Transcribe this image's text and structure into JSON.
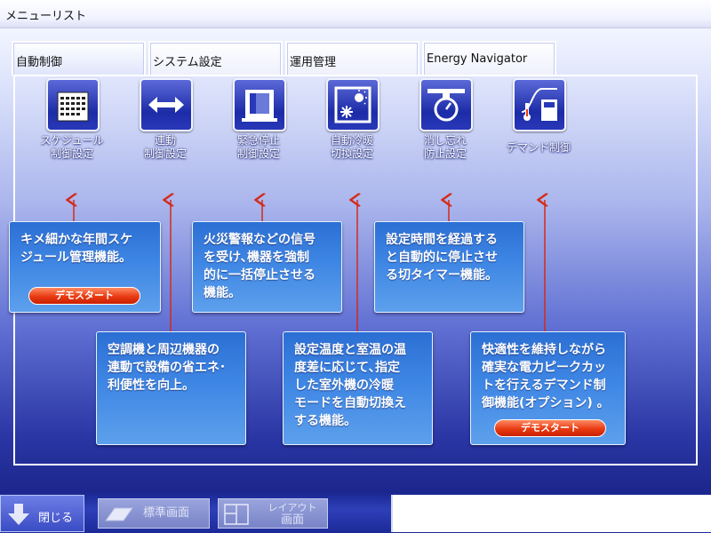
{
  "window": {
    "title": "メニューリスト"
  },
  "tabs": [
    {
      "label": "自動制御",
      "active": true
    },
    {
      "label": "システム設定",
      "active": false
    },
    {
      "label": "運用管理",
      "active": false
    },
    {
      "label": "Energy Navigator",
      "active": false
    }
  ],
  "functions": [
    {
      "icon": "calendar-icon",
      "line1": "スケジュール",
      "line2": "制御設定"
    },
    {
      "icon": "double-arrow-icon",
      "line1": "連動",
      "line2": "制御設定"
    },
    {
      "icon": "emergency-stop-icon",
      "line1": "緊急停止",
      "line2": "制御設定"
    },
    {
      "icon": "heat-cool-switch-icon",
      "line1": "自動冷暖",
      "line2": "切換設定"
    },
    {
      "icon": "stopwatch-icon",
      "line1": "消し忘れ",
      "line2": "防止設定"
    },
    {
      "icon": "demand-meter-icon",
      "line1": "デマンド制御",
      "line2": ""
    }
  ],
  "descriptions": {
    "schedule": "キメ細かな年間スケ\nジュール管理機能。",
    "interlock": "空調機と周辺機器の\n連動で設備の省エネ･\n利便性を向上。",
    "emergency": "火災警報などの信号\nを受け､機器を強制\n的に一括停止させる\n機能。",
    "auto_switch": "設定温度と室温の温\n度差に応じて､指定\nした室外機の冷暖\nモードを自動切換え\nする機能。",
    "off_timer": "設定時間を経過する\nと自動的に停止させ\nる切タイマー機能。",
    "demand": "快適性を維持しながら\n確実な電力ピークカッ\nトを行えるデマンド制\n御機能(オプション) 。"
  },
  "demo_button_label": "デモスタート",
  "bottom": {
    "close_label": "閉じる",
    "standard_screen_label": "標準画面",
    "layout_screen_line1": "レイアウト",
    "layout_screen_line2": "画面"
  },
  "colors": {
    "arrow": "#d42a1a",
    "demo_button": "#e83a12",
    "description_box": "#3e86e4",
    "bottom_bar": "#2e3fb8"
  }
}
